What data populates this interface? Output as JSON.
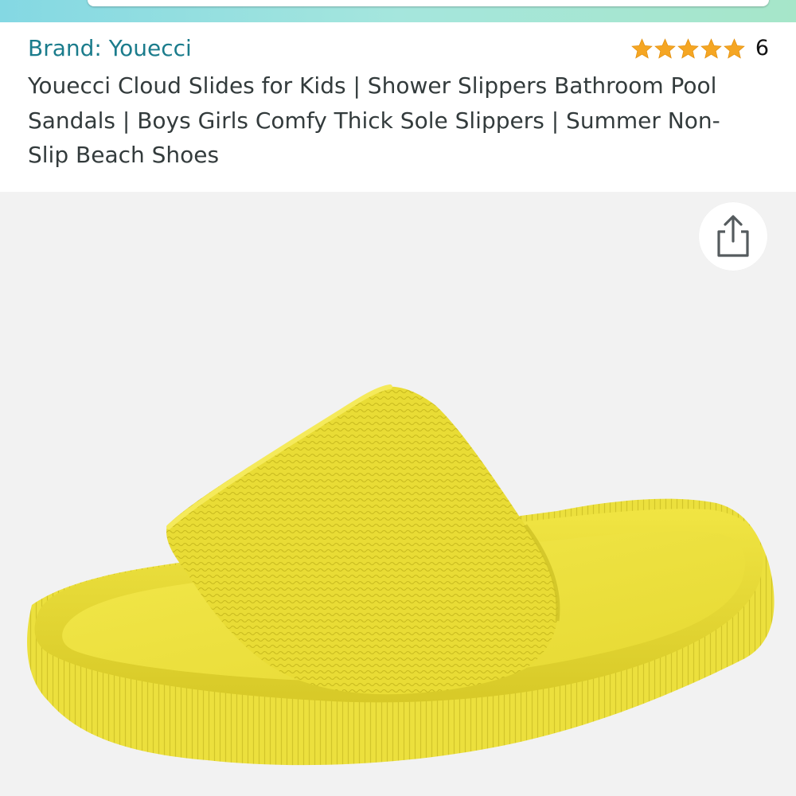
{
  "header": {
    "search": {
      "placeholder": ""
    }
  },
  "product": {
    "brand_label": "Brand: Youecci",
    "rating": {
      "stars": 5,
      "count": "6"
    },
    "title": "Youecci Cloud Slides for Kids | Shower Slippers Bathroom Pool Sandals | Boys Girls Comfy Thick Sole Slippers | Summer Non-Slip Beach Shoes"
  },
  "image": {
    "subject": "yellow-slide-sandal",
    "share_icon": "share-icon"
  },
  "colors": {
    "brand_link": "#1b7c8c",
    "title_text": "#333b3c",
    "star": "#f5a623",
    "image_bg": "#f2f2f2",
    "sandal_yellow": "#ede03a"
  }
}
